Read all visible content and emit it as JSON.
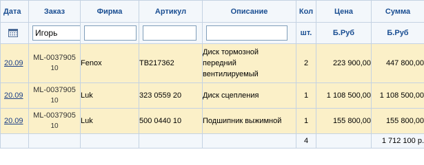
{
  "columns": {
    "date": "Дата",
    "order": "Заказ",
    "company": "Фирма",
    "article": "Артикул",
    "description": "Описание",
    "qty": "Кол",
    "price": "Цена",
    "sum": "Сумма"
  },
  "filters": {
    "order_value": "Игорь",
    "company_value": "",
    "article_value": "",
    "description_value": "",
    "qty_unit": "шт.",
    "price_unit": "Б.Руб",
    "sum_unit": "Б.Руб",
    "calendar_icon": "calendar-icon"
  },
  "rows": [
    {
      "date": "20.09",
      "order": "ML-0037905",
      "order_qty": "10",
      "company": "Fenox",
      "article": "TB217362",
      "description_lines": [
        "Диск тормозной",
        "передний",
        "вентилируемый"
      ],
      "qty": "2",
      "price": "223 900,00",
      "sum": "447 800,00"
    },
    {
      "date": "20.09",
      "order": "ML-0037905",
      "order_qty": "10",
      "company": "Luk",
      "article": "323 0559 20",
      "description_lines": [
        "Диск сцепления"
      ],
      "qty": "1",
      "price": "1 108 500,00",
      "sum": "1 108 500,00"
    },
    {
      "date": "20.09",
      "order": "ML-0037905",
      "order_qty": "10",
      "company": "Luk",
      "article": "500 0440 10",
      "description_lines": [
        "Подшипник выжимной"
      ],
      "qty": "1",
      "price": "155 800,00",
      "sum": "155 800,00"
    }
  ],
  "footer": {
    "qty_total": "4",
    "sum_total": "1 712 100 р."
  }
}
